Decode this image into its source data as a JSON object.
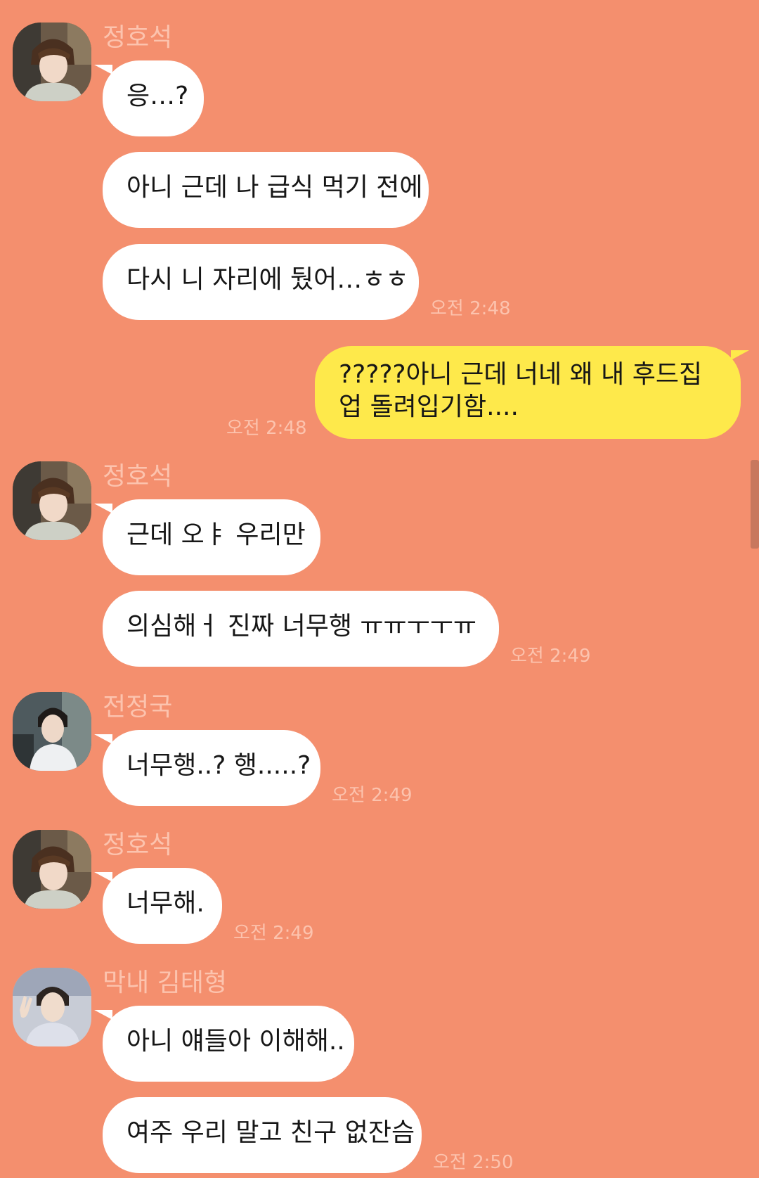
{
  "colors": {
    "background": "#F48F6E",
    "incoming_bubble": "#FFFFFF",
    "outgoing_bubble": "#FEE94B",
    "meta_text": "#FCC3AE"
  },
  "groups": [
    {
      "sender": "정호석",
      "avatar_icon": "profile-photo-icon",
      "messages": [
        "응…?",
        "아니 근데 나 급식 먹기 전에",
        "다시 니 자리에 뒀어…ㅎㅎ"
      ],
      "time": "오전 2:48"
    },
    {
      "sender": "",
      "outgoing": true,
      "messages": [
        "?????아니 근데 너네 왜 내 후드집업 돌려입기함...."
      ],
      "time": "오전 2:48"
    },
    {
      "sender": "정호석",
      "avatar_icon": "profile-photo-icon",
      "messages": [
        "근데 오ㅑ 우리만",
        "의심해ㅓ 진짜 너무행 ㅠㅠㅜㅜㅠ"
      ],
      "time": "오전 2:49"
    },
    {
      "sender": "전정국",
      "avatar_icon": "profile-photo-icon",
      "messages": [
        "너무행..? 행.....?"
      ],
      "time": "오전 2:49"
    },
    {
      "sender": "정호석",
      "avatar_icon": "profile-photo-icon",
      "messages": [
        "너무해."
      ],
      "time": "오전 2:49"
    },
    {
      "sender": "막내 김태형",
      "avatar_icon": "profile-photo-icon",
      "messages": [
        "아니 얘들아 이해해..",
        "여주 우리 말고 친구 없잔슴"
      ],
      "time": "오전 2:50"
    }
  ]
}
